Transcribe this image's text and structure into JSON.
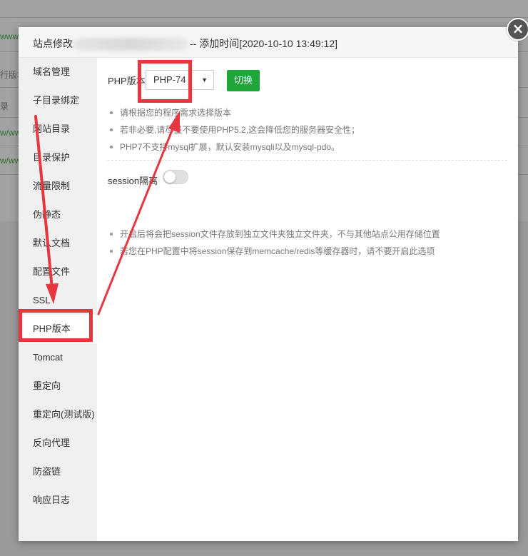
{
  "background": {
    "rows": [
      {
        "text": "www.fi",
        "link": true
      },
      {
        "text": "行版本",
        "link": false
      },
      {
        "text": "录",
        "link": false
      },
      {
        "text": "w/ww",
        "link": true
      },
      {
        "text": "w/ww",
        "link": true
      }
    ]
  },
  "modal": {
    "title_prefix": "站点修改",
    "title_suffix": "-- 添加时间[2020-10-10 13:49:12]",
    "close_label": "×"
  },
  "sidebar": {
    "items": [
      {
        "label": "域名管理"
      },
      {
        "label": "子目录绑定"
      },
      {
        "label": "网站目录"
      },
      {
        "label": "目录保护"
      },
      {
        "label": "流量限制"
      },
      {
        "label": "伪静态"
      },
      {
        "label": "默认文档"
      },
      {
        "label": "配置文件"
      },
      {
        "label": "SSL"
      },
      {
        "label": "PHP版本"
      },
      {
        "label": "Tomcat"
      },
      {
        "label": "重定向"
      },
      {
        "label": "重定向(测试版)"
      },
      {
        "label": "反向代理"
      },
      {
        "label": "防盗链"
      },
      {
        "label": "响应日志"
      }
    ],
    "active_index": 9
  },
  "php": {
    "label": "PHP版本",
    "selected": "PHP-74",
    "switch_label": "切换",
    "tips": [
      "请根据您的程序需求选择版本",
      "若非必要,请尽量不要使用PHP5.2,这会降低您的服务器安全性；",
      "PHP7不支持mysql扩展，默认安装mysqli以及mysql-pdo。"
    ]
  },
  "session": {
    "label": "session隔离",
    "enabled": false,
    "tips": [
      "开启后将会把session文件存放到独立文件夹独立文件夹，不与其他站点公用存储位置",
      "若您在PHP配置中将session保存到memcache/redis等缓存器时，请不要开启此选项"
    ]
  },
  "colors": {
    "accent_green": "#20a53a",
    "annotation_red": "#e8363f"
  },
  "icons": {
    "close": "close-icon",
    "select_arrow": "chevron-down-icon"
  }
}
